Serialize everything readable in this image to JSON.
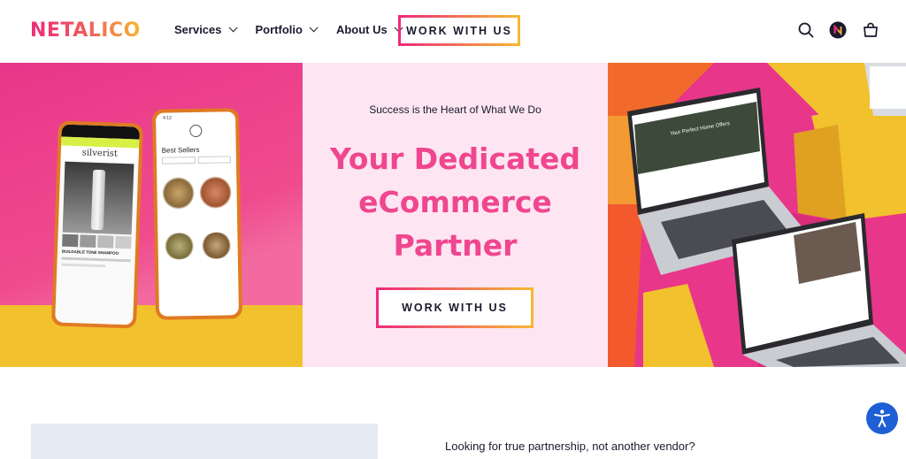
{
  "header": {
    "logo": "NETALICO",
    "nav": [
      {
        "label": "Services"
      },
      {
        "label": "Portfolio"
      },
      {
        "label": "About Us"
      }
    ],
    "cta_label": "WORK WITH US",
    "icons": [
      "search-icon",
      "account-avatar-icon",
      "cart-icon"
    ]
  },
  "hero": {
    "tagline": "Success is the Heart of What We Do",
    "headline_line1": "Your Dedicated",
    "headline_line2": "eCommerce",
    "headline_line3": "Partner",
    "cta_label": "WORK WITH US",
    "left_phone_brand": "silverist",
    "left_phone_product": "BUILDABLE TONE SHAMPOO",
    "right_phone_title": "Best Sellers",
    "laptop_banner": "Your Perfect Home Offers"
  },
  "below": {
    "text": "Looking for true partnership, not another vendor?"
  },
  "colors": {
    "brand_pink": "#f0468f",
    "brand_yellow": "#f7b733",
    "accessibility_blue": "#1f5fd6"
  }
}
